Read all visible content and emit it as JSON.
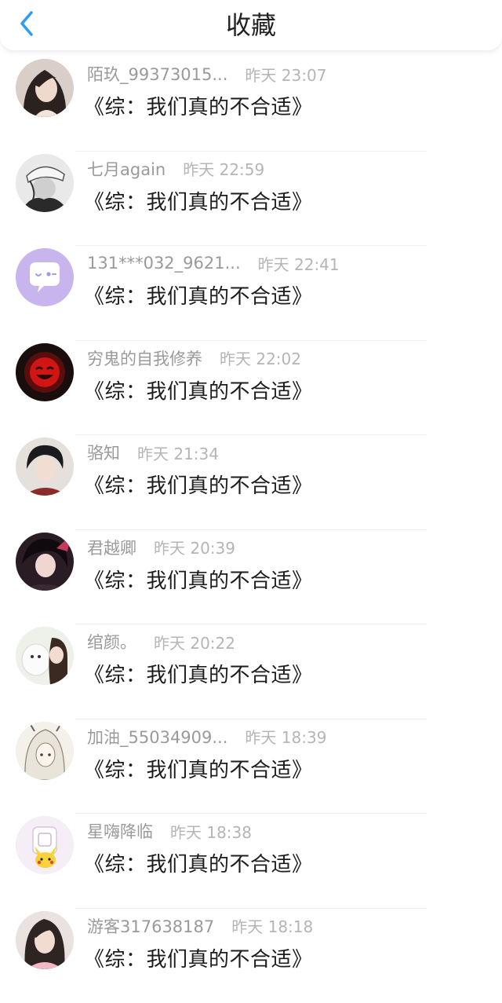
{
  "header": {
    "title": "收藏",
    "back_icon": "chevron-left-icon",
    "accent": "#2a9df4"
  },
  "favorites": [
    {
      "user": "陌玖_99373015...",
      "time": "昨天 23:07",
      "title": "《综：我们真的不合适》",
      "avatar": "girl-portrait"
    },
    {
      "user": "七月again",
      "time": "昨天 22:59",
      "title": "《综：我们真的不合适》",
      "avatar": "capped-figure"
    },
    {
      "user": "131***032_9621...",
      "time": "昨天 22:41",
      "title": "《综：我们真的不合适》",
      "avatar": "chat-bubble"
    },
    {
      "user": "穷鬼的自我修养",
      "time": "昨天 22:02",
      "title": "《综：我们真的不合适》",
      "avatar": "red-smiley"
    },
    {
      "user": "骆知",
      "time": "昨天 21:34",
      "title": "《综：我们真的不合适》",
      "avatar": "anime-boy"
    },
    {
      "user": "君越卿",
      "time": "昨天 20:39",
      "title": "《综：我们真的不合适》",
      "avatar": "anime-dark"
    },
    {
      "user": "绾颜。",
      "time": "昨天 20:22",
      "title": "《综：我们真的不合适》",
      "avatar": "girl-with-dog"
    },
    {
      "user": "加油_55034909...",
      "time": "昨天 18:39",
      "title": "《综：我们真的不合适》",
      "avatar": "anime-white-hair"
    },
    {
      "user": "星嗨降临",
      "time": "昨天 18:38",
      "title": "《综：我们真的不合适》",
      "avatar": "pikachu"
    },
    {
      "user": "游客317638187",
      "time": "昨天 18:18",
      "title": "《综：我们真的不合适》",
      "avatar": "girl-pink"
    }
  ]
}
